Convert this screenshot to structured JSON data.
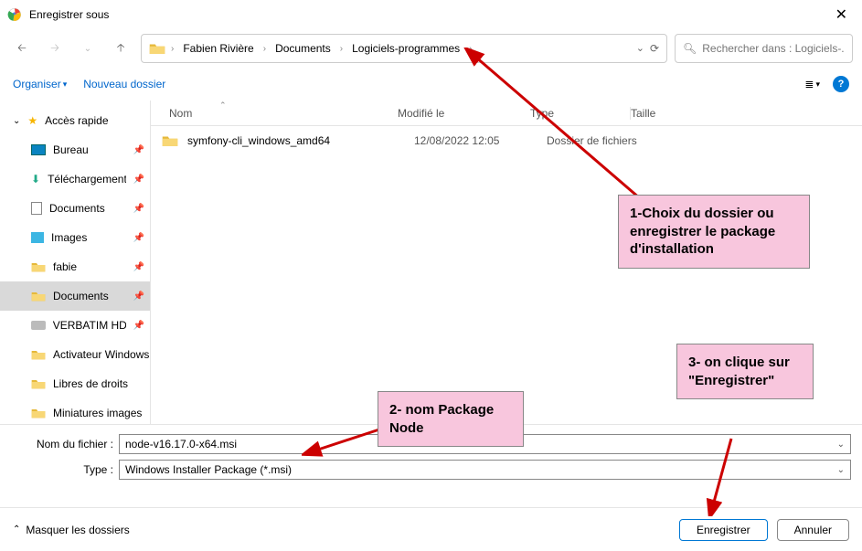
{
  "window": {
    "title": "Enregistrer sous"
  },
  "breadcrumbs": {
    "seg1": "Fabien Rivière",
    "seg2": "Documents",
    "seg3": "Logiciels-programmes"
  },
  "search": {
    "placeholder": "Rechercher dans : Logiciels-..."
  },
  "toolbar": {
    "organiser": "Organiser",
    "new_folder": "Nouveau dossier"
  },
  "sidebar": {
    "quick": "Accès rapide",
    "items": [
      {
        "label": "Bureau"
      },
      {
        "label": "Téléchargements"
      },
      {
        "label": "Documents"
      },
      {
        "label": "Images"
      },
      {
        "label": "fabie"
      },
      {
        "label": "Documents"
      },
      {
        "label": "VERBATIM HD"
      },
      {
        "label": "Activateur Windows"
      },
      {
        "label": "Libres de droits"
      },
      {
        "label": "Miniatures images"
      }
    ]
  },
  "columns": {
    "name": "Nom",
    "modified": "Modifié le",
    "type": "Type",
    "size": "Taille"
  },
  "files": [
    {
      "name": "symfony-cli_windows_amd64",
      "modified": "12/08/2022 12:05",
      "type": "Dossier de fichiers"
    }
  ],
  "form": {
    "filename_label": "Nom du fichier :",
    "filename_value": "node-v16.17.0-x64.msi",
    "type_label": "Type :",
    "type_value": "Windows Installer Package (*.msi)"
  },
  "footer": {
    "hide": "Masquer les dossiers",
    "save": "Enregistrer",
    "cancel": "Annuler"
  },
  "annotations": {
    "a1": "1-Choix du dossier ou enregistrer le package d'installation",
    "a2": "2- nom Package Node",
    "a3": "3- on clique sur \"Enregistrer\""
  }
}
